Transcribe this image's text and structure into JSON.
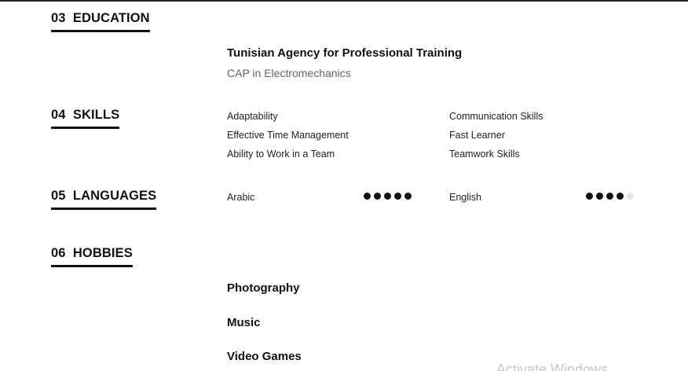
{
  "sections": {
    "education": {
      "title": "03  EDUCATION",
      "institution": "Tunisian Agency for Professional Training",
      "degree": "CAP in Electromechanics"
    },
    "skills": {
      "title": "04  SKILLS",
      "items": [
        "Adaptability",
        "Communication Skills",
        "Effective Time Management",
        "Fast Learner",
        "Ability to Work in a Team",
        "Teamwork Skills"
      ]
    },
    "languages": {
      "title": "05  LANGUAGES",
      "items": [
        {
          "name": "Arabic",
          "level": 5,
          "max": 5
        },
        {
          "name": "English",
          "level": 4,
          "max": 5
        }
      ]
    },
    "hobbies": {
      "title": "06  HOBBIES",
      "items": [
        "Photography",
        "Music",
        "Video Games"
      ]
    }
  },
  "watermark": "Activate Windows"
}
